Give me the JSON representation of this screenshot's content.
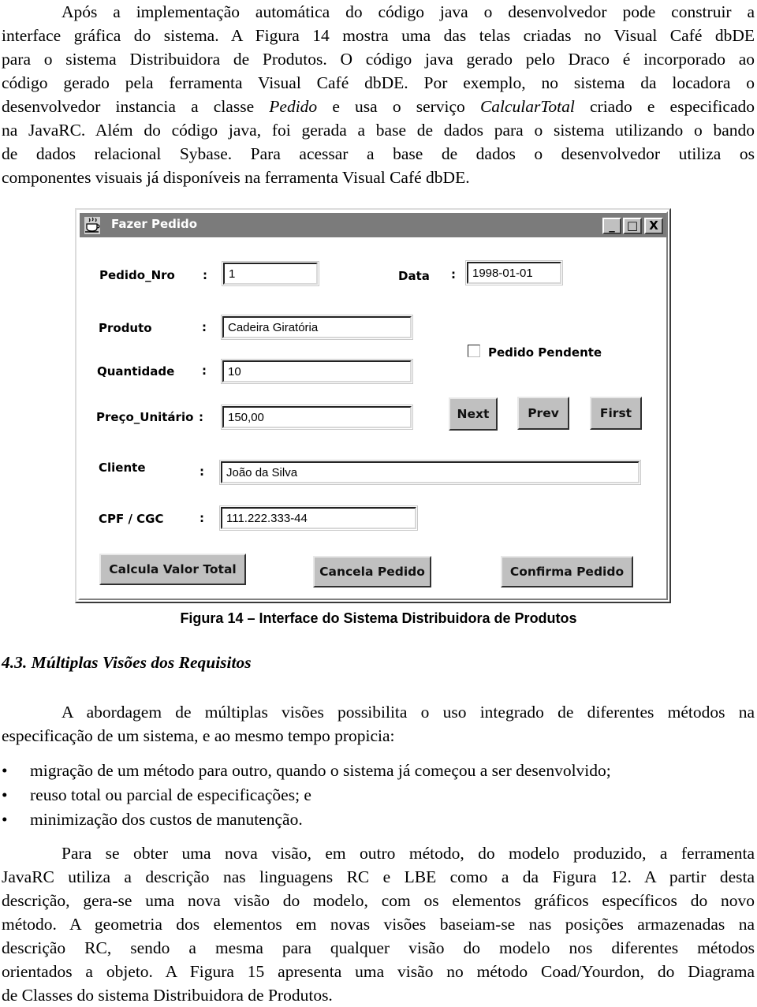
{
  "intro_paragraph": {
    "lines": [
      "Após a implementação automática do código java o desenvolvedor pode construir a",
      "interface gráfica do sistema. A Figura 14 mostra uma das telas criadas no Visual Café dbDE",
      "para o sistema Distribuidora de Produtos. O código java gerado pelo Draco é incorporado ao",
      "código gerado pela ferramenta Visual Café dbDE. Por exemplo, no sistema da locadora o",
      [
        "desenvolvedor instancia a classe ",
        "Pedido",
        " e usa o serviço ",
        "CalcularTotal",
        " criado e especificado"
      ],
      "na JavaRC. Além do código java, foi gerada a base de dados para o sistema utilizando o bando",
      "de dados relacional Sybase. Para acessar a base de dados o desenvolvedor utiliza os",
      "componentes visuais já disponíveis na ferramenta Visual Café dbDE."
    ]
  },
  "window": {
    "title": "Fazer Pedido",
    "icon": "java-cup-icon",
    "controls": {
      "minimize": "_",
      "maximize": "□",
      "close": "X"
    },
    "fields": {
      "pedido_nro": {
        "label": "Pedido_Nro",
        "colon": ":",
        "value": "1"
      },
      "data": {
        "label": "Data",
        "colon": ":",
        "value": "1998-01-01"
      },
      "produto": {
        "label": "Produto",
        "colon": ":",
        "value": "Cadeira Giratória"
      },
      "quantidade": {
        "label": "Quantidade",
        "colon": ":",
        "value": "10"
      },
      "preco_unitario": {
        "label": "Preço_Unitário",
        "colon": ":",
        "value": "150,00"
      },
      "cliente": {
        "label": "Cliente",
        "colon": ":",
        "value": "João da Silva"
      },
      "cpf_cgc": {
        "label": "CPF / CGC",
        "colon": ":",
        "value": "111.222.333-44"
      }
    },
    "checkbox": {
      "label": "Pedido Pendente",
      "checked": false
    },
    "nav_buttons": {
      "next": "Next",
      "prev": "Prev",
      "first": "First"
    },
    "action_buttons": {
      "calcula": "Calcula Valor Total",
      "cancela": "Cancela Pedido",
      "confirma": "Confirma Pedido"
    }
  },
  "figure_caption": "Figura 14 – Interface do Sistema Distribuidora de Produtos",
  "section_heading": "4.3. Múltiplas Visões dos Requisitos",
  "section_paragraph": {
    "lines": [
      "A abordagem de múltiplas visões possibilita o uso integrado de diferentes métodos na",
      "especificação de um sistema, e ao mesmo tempo propicia:"
    ]
  },
  "bullet_marker": "•",
  "bullets": [
    "migração de um método para outro, quando o sistema já começou a ser desenvolvido;",
    "reuso total ou parcial de especificações; e",
    "minimização dos custos de manutenção."
  ],
  "closing_paragraph": {
    "lines": [
      "Para se obter uma nova visão, em outro método, do modelo produzido, a ferramenta",
      "JavaRC utiliza a descrição nas linguagens RC e LBE como a da Figura 12. A partir desta",
      "descrição, gera-se uma nova visão do modelo, com os elementos gráficos específicos do novo",
      "método. A geometria dos elementos em novas visões baseiam-se nas posições armazenadas na",
      "descrição RC, sendo a mesma para qualquer visão do modelo nos diferentes métodos",
      "orientados a objeto. A Figura 15 apresenta uma visão no método Coad/Yourdon, do Diagrama",
      "de Classes do sistema Distribuidora de Produtos."
    ]
  }
}
